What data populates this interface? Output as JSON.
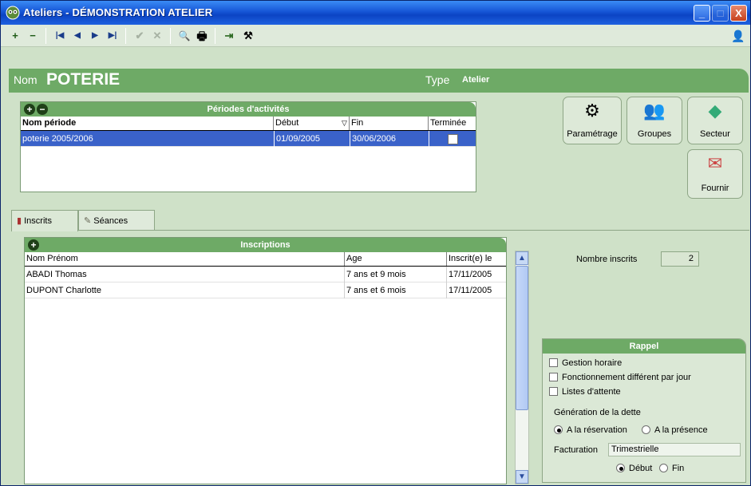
{
  "window": {
    "title": "Ateliers - DÉMONSTRATION ATELIER",
    "min": "_",
    "max": "□",
    "close": "X"
  },
  "toolbar": {
    "add": "+",
    "remove": "−",
    "first": "|◀",
    "prev": "◀",
    "next": "▶",
    "last": "▶|",
    "validate": "✔",
    "cancel": "✕",
    "search": "🔍",
    "print": "🖶",
    "exit": "⇥",
    "tools": "⚒",
    "person": "👤"
  },
  "header": {
    "nom_label": "Nom",
    "nom_value": "POTERIE",
    "type_label": "Type",
    "type_value": "Atelier"
  },
  "periods": {
    "title": "Périodes d'activités",
    "columns": [
      "Nom période",
      "Début",
      "Fin",
      "Terminée"
    ],
    "sort_icon": "▽",
    "rows": [
      {
        "name": "poterie 2005/2006",
        "start": "01/09/2005",
        "end": "30/06/2006",
        "done": false
      }
    ]
  },
  "buttons": {
    "parametrage": "Paramétrage",
    "groupes": "Groupes",
    "secteur": "Secteur",
    "fournir": "Fournir"
  },
  "tabs": [
    {
      "label": "Inscrits",
      "icon": "people-icon"
    },
    {
      "label": "Séances",
      "icon": "pen-icon"
    }
  ],
  "inscriptions": {
    "title": "Inscriptions",
    "columns": [
      "Nom Prénom",
      "Age",
      "Inscrit(e) le"
    ],
    "rows": [
      {
        "name": "ABADI Thomas",
        "age": "7 ans et 9 mois",
        "date": "17/11/2005"
      },
      {
        "name": "DUPONT Charlotte",
        "age": "7 ans et 6 mois",
        "date": "17/11/2005"
      }
    ]
  },
  "count": {
    "label": "Nombre inscrits",
    "value": "2"
  },
  "rappel": {
    "title": "Rappel",
    "checks": [
      "Gestion horaire",
      "Fonctionnement différent par jour",
      "Listes d'attente"
    ],
    "dette_label": "Génération de la dette",
    "dette_options": [
      "A la réservation",
      "A la présence"
    ],
    "facturation_label": "Facturation",
    "facturation_value": "Trimestrielle",
    "period_options": [
      "Début",
      "Fin"
    ]
  },
  "colors": {
    "green": "#6eaa66",
    "bg": "#cfe1c8",
    "selection": "#3a62c9",
    "titlebar": "#1656d6"
  }
}
